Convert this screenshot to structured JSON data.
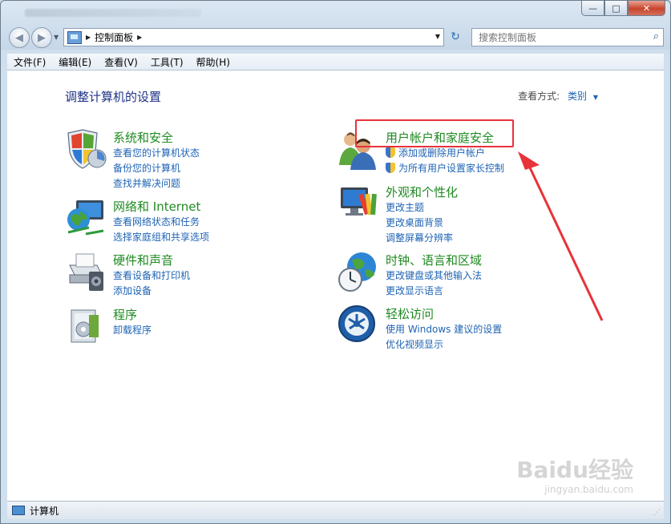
{
  "window": {
    "minimize_glyph": "—",
    "maximize_glyph": "□",
    "close_glyph": "✕"
  },
  "address_bar": {
    "location": "控制面板",
    "search_placeholder": "搜索控制面板"
  },
  "menu": [
    "文件(F)",
    "编辑(E)",
    "查看(V)",
    "工具(T)",
    "帮助(H)"
  ],
  "content": {
    "heading": "调整计算机的设置",
    "view_mode_label": "查看方式:",
    "view_mode_value": "类别"
  },
  "categories": [
    {
      "icon": "system-security-icon",
      "title": "系统和安全",
      "links": [
        "查看您的计算机状态",
        "备份您的计算机",
        "查找并解决问题"
      ]
    },
    {
      "icon": "network-internet-icon",
      "title": "网络和 Internet",
      "links": [
        "查看网络状态和任务",
        "选择家庭组和共享选项"
      ]
    },
    {
      "icon": "hardware-sound-icon",
      "title": "硬件和声音",
      "links": [
        "查看设备和打印机",
        "添加设备"
      ]
    },
    {
      "icon": "programs-icon",
      "title": "程序",
      "links": [
        "卸载程序"
      ]
    },
    {
      "icon": "user-accounts-icon",
      "title": "用户帐户和家庭安全",
      "links": [
        "添加或删除用户帐户",
        "为所有用户设置家长控制"
      ]
    },
    {
      "icon": "appearance-icon",
      "title": "外观和个性化",
      "links": [
        "更改主题",
        "更改桌面背景",
        "调整屏幕分辨率"
      ]
    },
    {
      "icon": "clock-language-region-icon",
      "title": "时钟、语言和区域",
      "links": [
        "更改键盘或其他输入法",
        "更改显示语言"
      ]
    },
    {
      "icon": "ease-of-access-icon",
      "title": "轻松访问",
      "links": [
        "使用 Windows 建议的设置",
        "优化视频显示"
      ]
    }
  ],
  "status_bar": {
    "text": "计算机"
  },
  "watermark": {
    "main": "Baidu经验",
    "sub": "jingyan.baidu.com"
  },
  "colors": {
    "category_title": "#1f8a21",
    "link": "#1e63b4",
    "heading": "#1e3287",
    "annotation": "#e8323a"
  }
}
